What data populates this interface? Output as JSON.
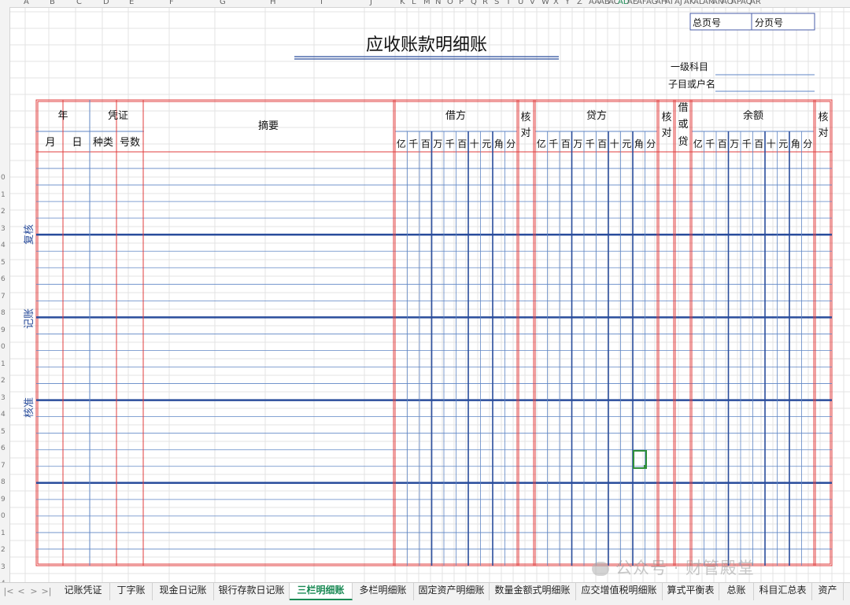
{
  "spreadsheet": {
    "column_headers": [
      "A",
      "B",
      "C",
      "D",
      "E",
      "F",
      "G",
      "H",
      "I",
      "J",
      "K",
      "L",
      "M",
      "N",
      "O",
      "P",
      "Q",
      "R",
      "S",
      "T",
      "U",
      "V",
      "W",
      "X",
      "Y",
      "Z",
      "AA",
      "AB",
      "AC",
      "AD",
      "AE",
      "AF",
      "AG",
      "AH",
      "AI",
      "AJ",
      "AK",
      "AL",
      "AM",
      "AN",
      "AO",
      "AP",
      "AQ",
      "AR"
    ],
    "active_column": "AD",
    "row_header_labels": [
      "0",
      "1",
      "2",
      "3",
      "4",
      "5",
      "6",
      "7",
      "8",
      "9",
      "0",
      "1",
      "2",
      "3",
      "4",
      "5",
      "6",
      "7",
      "8",
      "9",
      "0",
      "1",
      "2",
      "3",
      "4"
    ]
  },
  "ledger": {
    "title": "应收账款明细账",
    "page_total_label": "总页号",
    "page_sub_label": "分页号",
    "level1_subject_label": "一级科目",
    "sub_subject_label": "子目或户名",
    "headers": {
      "year": "年",
      "month": "月",
      "day": "日",
      "voucher": "凭证",
      "voucher_type": "种类",
      "voucher_no": "号数",
      "summary": "摘要",
      "debit": "借方",
      "check1": "核对",
      "credit": "贷方",
      "check2": "核对",
      "dr_or_cr": "借或贷",
      "balance": "余额",
      "check3": "核对"
    },
    "amount_units": [
      "亿",
      "千",
      "百",
      "万",
      "千",
      "百",
      "十",
      "元",
      "角",
      "分"
    ],
    "side_labels": [
      "复核",
      "记账",
      "核准"
    ],
    "body_rows": 25
  },
  "tabs": [
    {
      "label": "记账凭证",
      "active": false
    },
    {
      "label": "丁字账",
      "active": false
    },
    {
      "label": "现金日记账",
      "active": false
    },
    {
      "label": "银行存款日记账",
      "active": false
    },
    {
      "label": "三栏明细账",
      "active": true
    },
    {
      "label": "多栏明细账",
      "active": false
    },
    {
      "label": "固定资产明细账",
      "active": false
    },
    {
      "label": "数量金额式明细账",
      "active": false
    },
    {
      "label": "应交增值税明细账",
      "active": false
    },
    {
      "label": "算式平衡表",
      "active": false
    },
    {
      "label": "总账",
      "active": false
    },
    {
      "label": "科目汇总表",
      "active": false
    },
    {
      "label": "资产",
      "active": false
    }
  ],
  "nav_buttons": [
    "|<",
    "<",
    ">",
    ">|"
  ],
  "watermark": "公众号 · 财管殿堂",
  "colors": {
    "red_border": "#e03c3c",
    "blue_line": "#2a4d9c",
    "thin_blue": "#5f86c5",
    "gridline": "#e3e3e3",
    "active_tab": "#1b8a55",
    "selection": "#2f8f3a"
  }
}
